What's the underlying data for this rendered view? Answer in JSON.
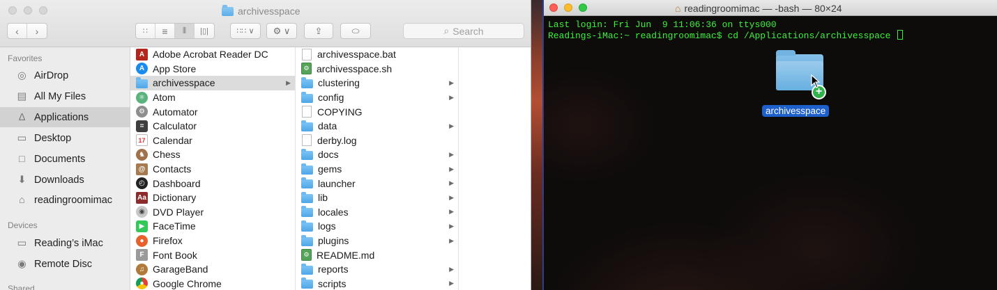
{
  "finder": {
    "title": "archivesspace",
    "search_placeholder": "Search",
    "sidebar": {
      "favorites_heading": "Favorites",
      "devices_heading": "Devices",
      "shared_heading": "Shared",
      "favorites": [
        {
          "label": "AirDrop",
          "icon": "airdrop-icon"
        },
        {
          "label": "All My Files",
          "icon": "all-files-icon"
        },
        {
          "label": "Applications",
          "icon": "applications-icon",
          "selected": true
        },
        {
          "label": "Desktop",
          "icon": "desktop-icon"
        },
        {
          "label": "Documents",
          "icon": "documents-icon"
        },
        {
          "label": "Downloads",
          "icon": "downloads-icon"
        },
        {
          "label": "readingroomimac",
          "icon": "home-icon"
        }
      ],
      "devices": [
        {
          "label": "Reading’s iMac",
          "icon": "imac-icon"
        },
        {
          "label": "Remote Disc",
          "icon": "disc-icon"
        }
      ]
    },
    "column1": [
      {
        "label": "Adobe Acrobat Reader DC",
        "icon": "acrobat-icon"
      },
      {
        "label": "App Store",
        "icon": "app-store-icon"
      },
      {
        "label": "archivesspace",
        "icon": "folder-icon",
        "selected": true,
        "arrow": true
      },
      {
        "label": "Atom",
        "icon": "atom-icon"
      },
      {
        "label": "Automator",
        "icon": "automator-icon"
      },
      {
        "label": "Calculator",
        "icon": "calculator-icon"
      },
      {
        "label": "Calendar",
        "icon": "calendar-icon"
      },
      {
        "label": "Chess",
        "icon": "chess-icon"
      },
      {
        "label": "Contacts",
        "icon": "contacts-icon"
      },
      {
        "label": "Dashboard",
        "icon": "dashboard-icon"
      },
      {
        "label": "Dictionary",
        "icon": "dictionary-icon"
      },
      {
        "label": "DVD Player",
        "icon": "dvd-player-icon"
      },
      {
        "label": "FaceTime",
        "icon": "facetime-icon"
      },
      {
        "label": "Firefox",
        "icon": "firefox-icon"
      },
      {
        "label": "Font Book",
        "icon": "font-book-icon"
      },
      {
        "label": "GarageBand",
        "icon": "garageband-icon"
      },
      {
        "label": "Google Chrome",
        "icon": "chrome-icon"
      }
    ],
    "column2": [
      {
        "label": "archivesspace.bat",
        "type": "doc"
      },
      {
        "label": "archivesspace.sh",
        "type": "script"
      },
      {
        "label": "clustering",
        "type": "folder",
        "arrow": true
      },
      {
        "label": "config",
        "type": "folder",
        "arrow": true
      },
      {
        "label": "COPYING",
        "type": "doc"
      },
      {
        "label": "data",
        "type": "folder",
        "arrow": true
      },
      {
        "label": "derby.log",
        "type": "doc"
      },
      {
        "label": "docs",
        "type": "folder",
        "arrow": true
      },
      {
        "label": "gems",
        "type": "folder",
        "arrow": true
      },
      {
        "label": "launcher",
        "type": "folder",
        "arrow": true
      },
      {
        "label": "lib",
        "type": "folder",
        "arrow": true
      },
      {
        "label": "locales",
        "type": "folder",
        "arrow": true
      },
      {
        "label": "logs",
        "type": "folder",
        "arrow": true
      },
      {
        "label": "plugins",
        "type": "folder",
        "arrow": true
      },
      {
        "label": "README.md",
        "type": "script"
      },
      {
        "label": "reports",
        "type": "folder",
        "arrow": true
      },
      {
        "label": "scripts",
        "type": "folder",
        "arrow": true
      }
    ]
  },
  "terminal": {
    "title": "readingroomimac — -bash — 80×24",
    "line1": "Last login: Fri Jun  9 11:06:36 on ttys000",
    "line2": "Readings-iMac:~ readingroomimac$ cd /Applications/archivesspace ",
    "drag_label": "archivesspace",
    "text_color": "#3df03d"
  }
}
